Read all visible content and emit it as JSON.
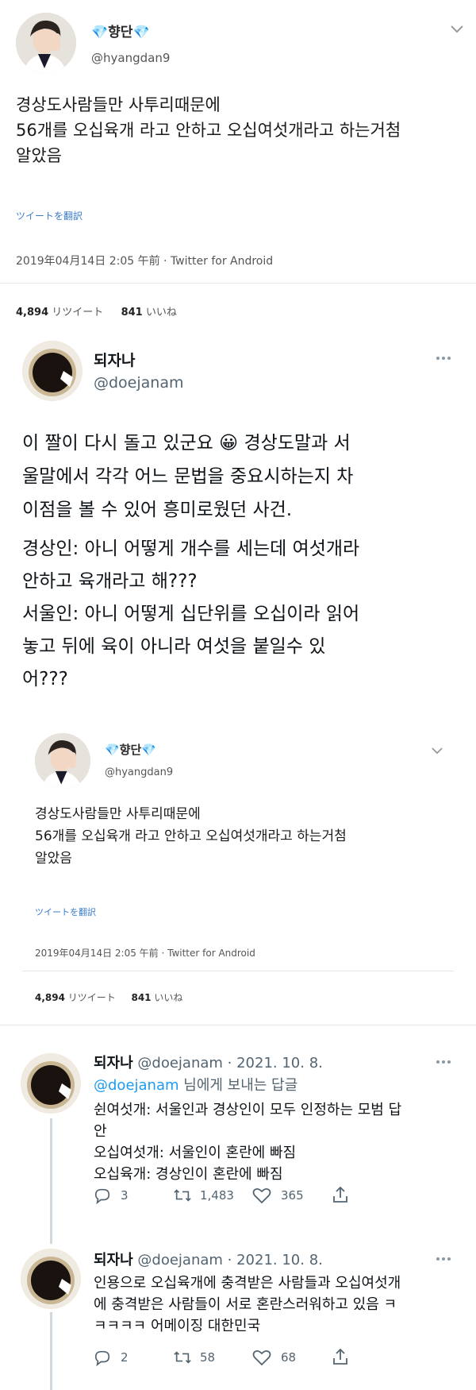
{
  "tweet1": {
    "display_name": "💎향단💎",
    "handle": "@hyangdan9",
    "text_lines": [
      "경상도사람들만 사투리때문에",
      "56개를 오십육개 라고 안하고 오십여섯개라고 하는거첨",
      "알았음"
    ],
    "translate_label": "ツイートを翻訳",
    "timestamp": "2019年04月14日 2:05 午前 · Twitter for Android",
    "retweet_count": "4,894",
    "retweet_label": "リツイート",
    "like_count": "841",
    "like_label": "いいね"
  },
  "tweet2": {
    "display_name": "되자나",
    "handle": "@doejanam",
    "para1_lines": [
      "이 짤이 다시 돌고 있군요 😀 경상도말과 서",
      "울말에서 각각 어느 문법을 중요시하는지 차",
      "이점을 볼 수 있어 흥미로웠던 사건."
    ],
    "para2_lines": [
      "경상인: 아니 어떻게 개수를 세는데 여섯개라",
      "안하고 육개라고 해???",
      "서울인: 아니 어떻게 십단위를 오십이라 읽어",
      "놓고 뒤에 육이 아니라 여섯을 붙일수 있",
      "어???"
    ]
  },
  "reply1": {
    "display_name": "되자나",
    "handle_date": "@doejanam · 2021. 10. 8.",
    "reply_to_handle": "@doejanam",
    "reply_to_suffix": " 님에게 보내는 답글",
    "text_lines": [
      "쉰여섯개: 서울인과 경상인이 모두 인정하는 모범 답",
      "안",
      "오십여섯개: 서울인이 혼란에 빠짐",
      "오십육개: 경상인이 혼란에 빠짐"
    ],
    "replies": "3",
    "retweets": "1,483",
    "likes": "365"
  },
  "reply2": {
    "display_name": "되자나",
    "handle_date": "@doejanam · 2021. 10. 8.",
    "text_lines": [
      "인용으로 오십육개에 충격받은 사람들과 오십여섯개",
      "에 충격받은 사람들이 서로 혼란스러워하고 있음 ㅋ",
      "ㅋㅋㅋㅋ 어메이징 대한민국"
    ],
    "replies": "2",
    "retweets": "58",
    "likes": "68"
  },
  "colors": {
    "link": "#1d9bf0",
    "muted": "#536471",
    "divider": "#e1e8ed"
  }
}
